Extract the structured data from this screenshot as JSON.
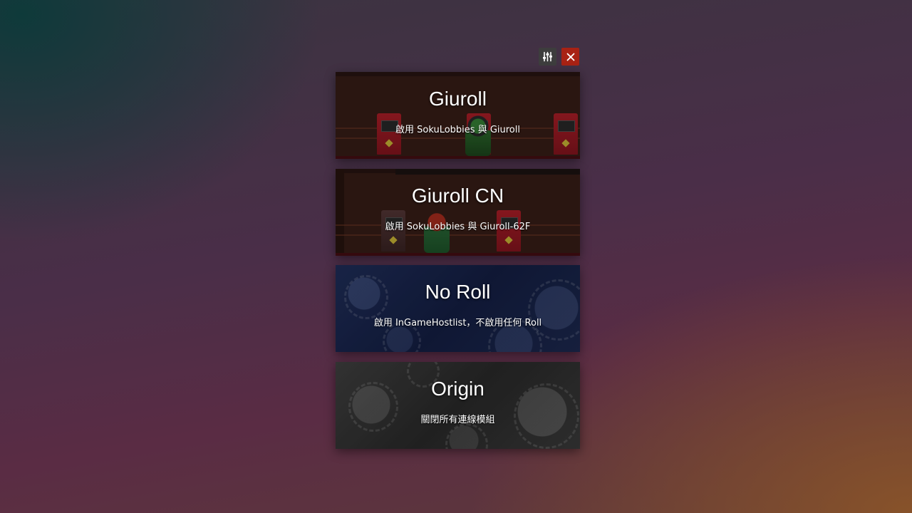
{
  "toolbar": {
    "settings_icon": "sliders-icon",
    "close_icon": "close-icon",
    "close_color": "#a82214"
  },
  "profiles": [
    {
      "title": "Giuroll",
      "description": "啟用 SokuLobbies 與 Giuroll"
    },
    {
      "title": "Giuroll CN",
      "description": "啟用 SokuLobbies 與 Giuroll-62F"
    },
    {
      "title": "No Roll",
      "description": "啟用 InGameHostlist，不啟用任何 Roll"
    },
    {
      "title": "Origin",
      "description": "關閉所有連線模組"
    }
  ]
}
